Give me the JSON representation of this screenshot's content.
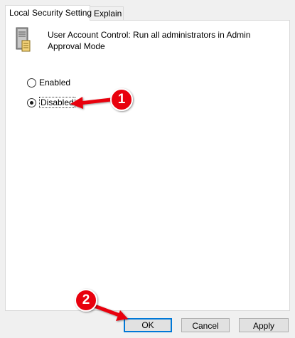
{
  "tabs": [
    {
      "label": "Local Security Setting",
      "active": true
    },
    {
      "label": "Explain",
      "active": false
    }
  ],
  "policy": {
    "icon": "server-policy-icon",
    "title": "User Account Control: Run all administrators in Admin Approval Mode"
  },
  "options": {
    "enabled_label": "Enabled",
    "disabled_label": "Disabled",
    "selected": "Disabled"
  },
  "buttons": {
    "ok": "OK",
    "cancel": "Cancel",
    "apply": "Apply"
  },
  "annotations": {
    "step1": "1",
    "step2": "2",
    "color": "#e8000b"
  }
}
